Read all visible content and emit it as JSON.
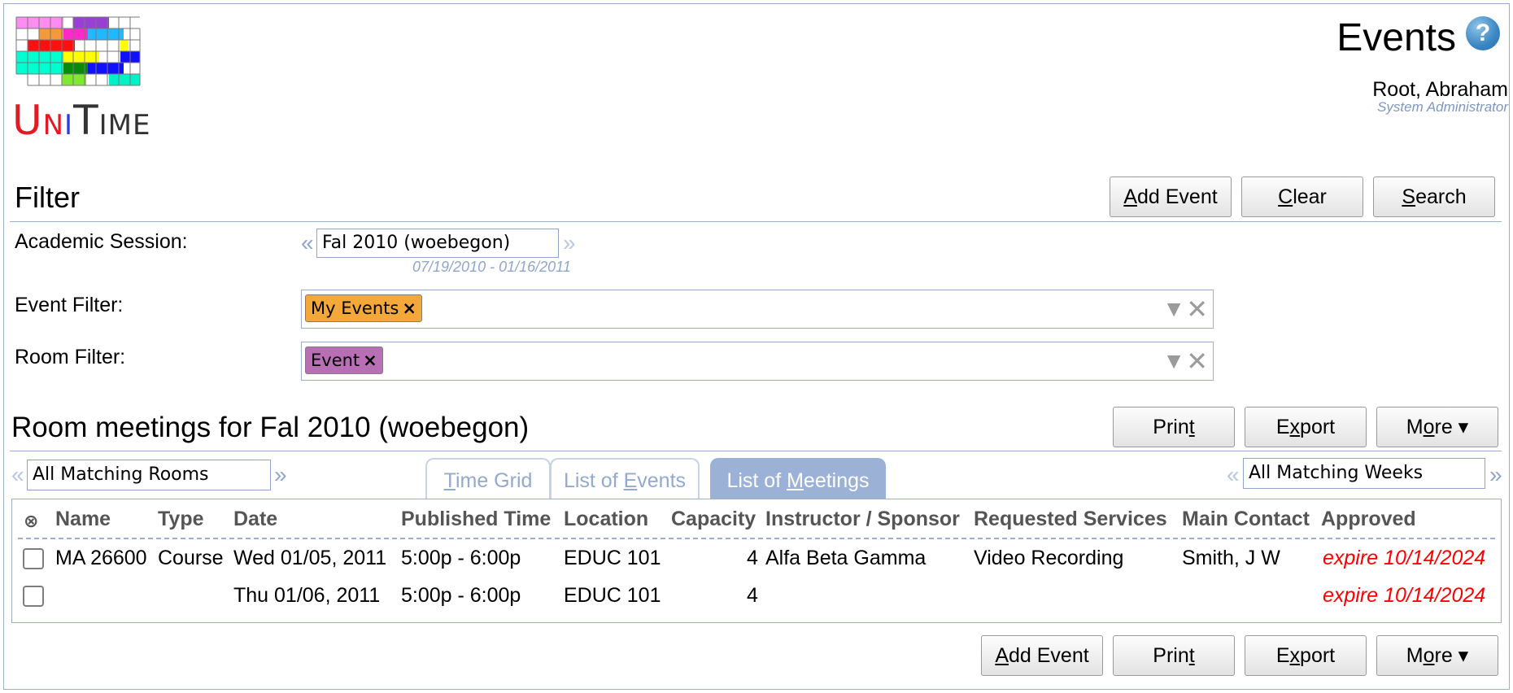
{
  "header": {
    "logo_text": "UniTime",
    "title": "Events",
    "help_icon": "?",
    "user_name": "Root, Abraham",
    "user_role": "System Administrator"
  },
  "filter": {
    "title": "Filter",
    "buttons": {
      "add_event": "Add Event",
      "clear": "Clear",
      "search": "Search"
    },
    "academic_session": {
      "label": "Academic Session:",
      "value": "Fal 2010 (woebegon)",
      "dates": "07/19/2010 - 01/16/2011"
    },
    "event_filter": {
      "label": "Event Filter:",
      "chip": "My Events",
      "chip_color": "#f5a83a"
    },
    "room_filter": {
      "label": "Room Filter:",
      "chip": "Event",
      "chip_color": "#b86fb6"
    }
  },
  "results": {
    "title": "Room meetings for Fal 2010 (woebegon)",
    "buttons": {
      "print": "Print",
      "export": "Export",
      "more": "More ▾"
    },
    "rooms_select": "All Matching Rooms",
    "weeks_select": "All Matching Weeks",
    "tabs": [
      "Time Grid",
      "List of Events",
      "List of Meetings"
    ],
    "active_tab": "List of Meetings",
    "columns": [
      "⊗",
      "Name",
      "Type",
      "Date",
      "Published Time",
      "Location",
      "Capacity",
      "Instructor / Sponsor",
      "Requested Services",
      "Main Contact",
      "Approved"
    ],
    "rows": [
      {
        "name": "MA 26600",
        "type": "Course",
        "date": "Wed 01/05, 2011",
        "time": "5:00p - 6:00p",
        "location": "EDUC 101",
        "capacity": "4",
        "instructor": "Alfa Beta Gamma",
        "services": "Video Recording",
        "contact": "Smith, J W",
        "approved": "expire 10/14/2024"
      },
      {
        "name": "",
        "type": "",
        "date": "Thu 01/06, 2011",
        "time": "5:00p - 6:00p",
        "location": "EDUC 101",
        "capacity": "4",
        "instructor": "",
        "services": "",
        "contact": "",
        "approved": "expire 10/14/2024"
      }
    ]
  },
  "footer_buttons": {
    "add_event": "Add Event",
    "print": "Print",
    "export": "Export",
    "more": "More ▾"
  }
}
